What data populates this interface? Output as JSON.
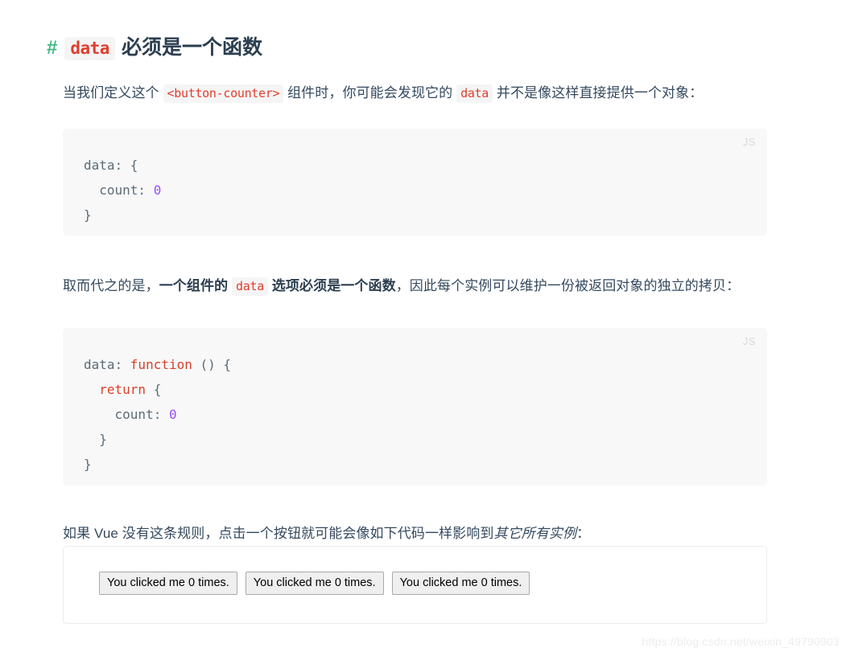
{
  "heading": {
    "anchor": "#",
    "code": "data",
    "text": "必须是一个函数"
  },
  "paragraphs": {
    "p1": {
      "part1": "当我们定义这个",
      "code1": "<button-counter>",
      "part2": "组件时，你可能会发现它的",
      "code2": "data",
      "part3": "并不是像这样直接提供一个对象："
    },
    "p2": {
      "part1": "取而代之的是，",
      "bold1": "一个组件的",
      "code1": "data",
      "bold2": "选项必须是一个函数",
      "part2": "，因此每个实例可以维护一份被返回对象的独立的拷贝："
    },
    "p3": {
      "part1": "如果 Vue 没有这条规则，点击一个按钮就可能会像如下代码一样影响到",
      "italic": "其它所有实例",
      "part2": "："
    }
  },
  "code_blocks": [
    {
      "lang_label": "JS",
      "lines": [
        [
          {
            "t": "data: {",
            "c": "tok-pl"
          }
        ],
        [
          {
            "t": "  count: ",
            "c": "tok-pl"
          },
          {
            "t": "0",
            "c": "tok-num"
          }
        ],
        [
          {
            "t": "}",
            "c": "tok-pl"
          }
        ]
      ]
    },
    {
      "lang_label": "JS",
      "lines": [
        [
          {
            "t": "data: ",
            "c": "tok-pl"
          },
          {
            "t": "function",
            "c": "tok-kw"
          },
          {
            "t": " () {",
            "c": "tok-pl"
          }
        ],
        [
          {
            "t": "  ",
            "c": "tok-pl"
          },
          {
            "t": "return",
            "c": "tok-kw"
          },
          {
            "t": " {",
            "c": "tok-pl"
          }
        ],
        [
          {
            "t": "    count: ",
            "c": "tok-pl"
          },
          {
            "t": "0",
            "c": "tok-num"
          }
        ],
        [
          {
            "t": "  }",
            "c": "tok-pl"
          }
        ],
        [
          {
            "t": "}",
            "c": "tok-pl"
          }
        ]
      ]
    }
  ],
  "demo": {
    "buttons": [
      {
        "label": "You clicked me 0 times."
      },
      {
        "label": "You clicked me 0 times."
      },
      {
        "label": "You clicked me 0 times."
      }
    ]
  },
  "watermark": "https://blog.csdn.net/weixin_49790903",
  "colors": {
    "anchor_green": "#42b983",
    "code_red": "#e03e2d",
    "keyword_red": "#d9402a",
    "number_purple": "#9b4dff",
    "text": "#2c3e50",
    "code_bg": "#f8f8f8",
    "inline_code_bg": "#f5f5f5",
    "lang_label": "#d6dade",
    "watermark": "#ededed"
  }
}
